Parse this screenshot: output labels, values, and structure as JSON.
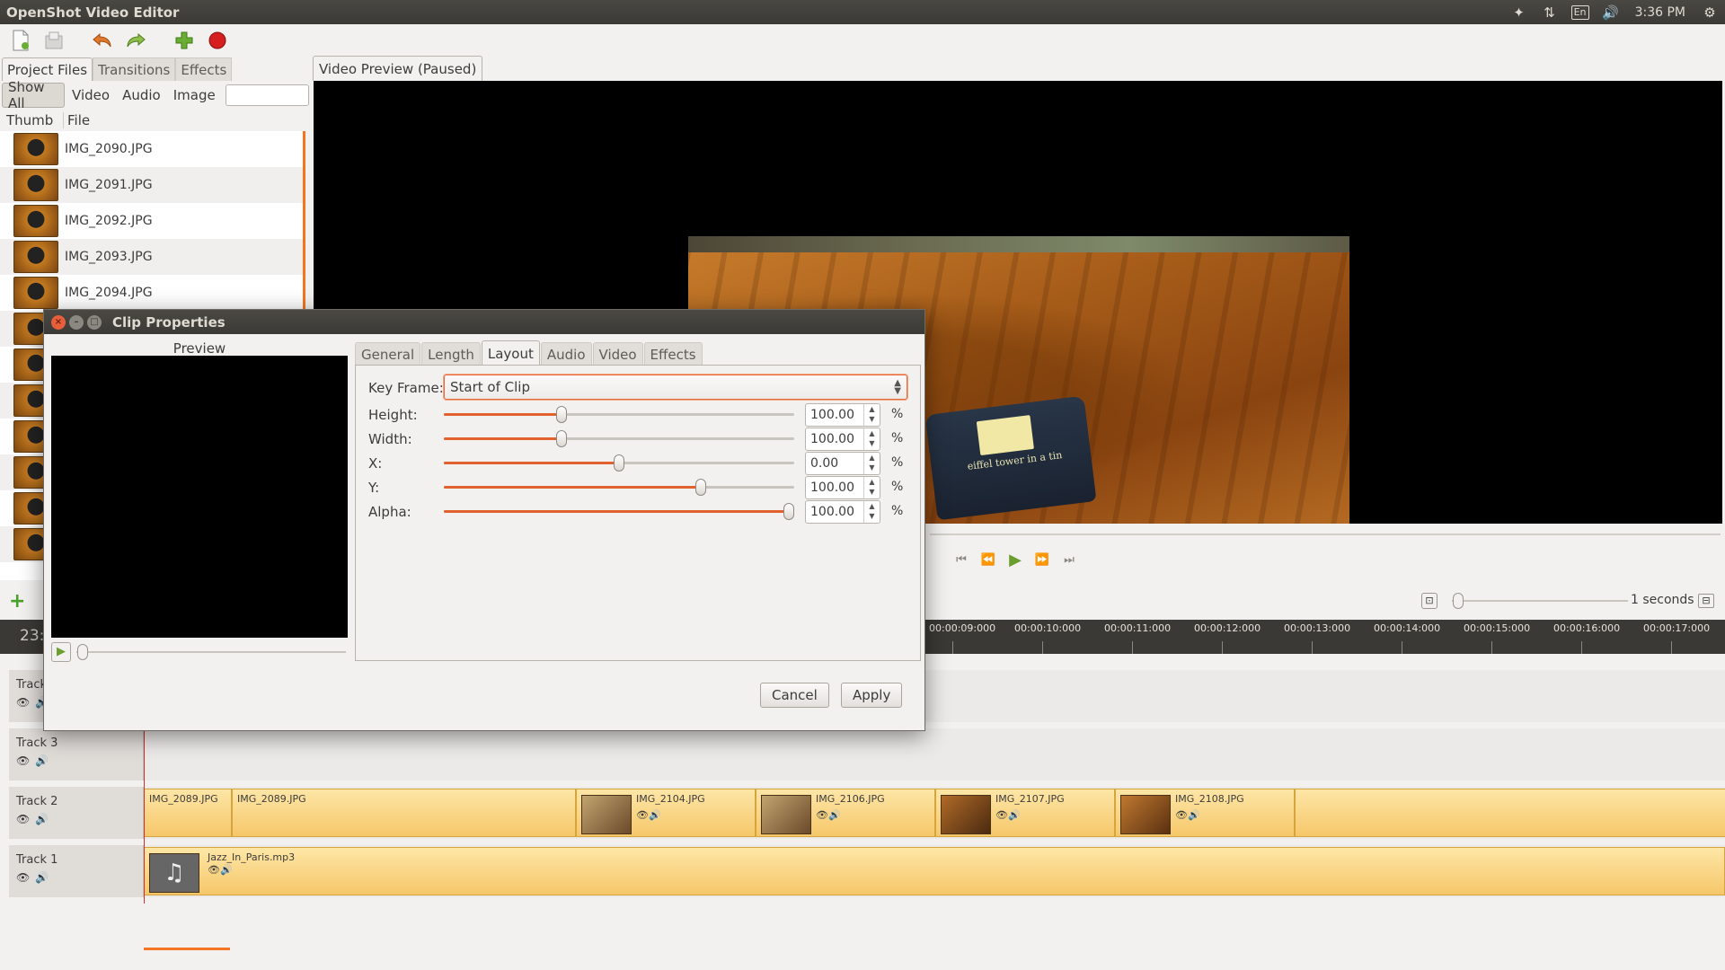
{
  "window": {
    "title": "OpenShot Video Editor",
    "indicators": {
      "keyboard": "En",
      "clock": "3:36 PM"
    }
  },
  "toolbar": {
    "new_icon": "new-project-icon",
    "save_icon": "save-icon",
    "undo_icon": "undo-icon",
    "redo_icon": "redo-icon",
    "import_icon": "add-icon",
    "record_icon": "record-icon"
  },
  "left_tabs": [
    "Project Files",
    "Transitions",
    "Effects"
  ],
  "filters": {
    "buttons": [
      "Show All",
      "Video",
      "Audio",
      "Image"
    ],
    "search_value": ""
  },
  "files": {
    "headers": {
      "thumb": "Thumb",
      "file": "File"
    },
    "rows": [
      "IMG_2090.JPG",
      "IMG_2091.JPG",
      "IMG_2092.JPG",
      "IMG_2093.JPG",
      "IMG_2094.JPG"
    ]
  },
  "preview": {
    "tab_label": "Video Preview (Paused)",
    "tin_text": "eiffel tower in a tin"
  },
  "timeline": {
    "zoom_label": "1 seconds",
    "current_time": "23:",
    "ticks": [
      "00:00:09:000",
      "00:00:10:000",
      "00:00:11:000",
      "00:00:12:000",
      "00:00:13:000",
      "00:00:14:000",
      "00:00:15:000",
      "00:00:16:000",
      "00:00:17:000"
    ],
    "tracks": [
      {
        "name": "Track",
        "clips": []
      },
      {
        "name": "Track 3",
        "clips": []
      },
      {
        "name": "Track 2",
        "clips": [
          "IMG_2089.JPG",
          "IMG_2089.JPG",
          "IMG_2104.JPG",
          "IMG_2106.JPG",
          "IMG_2107.JPG",
          "IMG_2108.JPG"
        ]
      },
      {
        "name": "Track 1",
        "clips": [
          "Jazz_In_Paris.mp3"
        ]
      }
    ]
  },
  "dialog": {
    "title": "Clip Properties",
    "preview_label": "Preview",
    "tabs": [
      "General",
      "Length",
      "Layout",
      "Audio",
      "Video",
      "Effects"
    ],
    "active_tab": "Layout",
    "keyframe_label": "Key Frame:",
    "keyframe_value": "Start of Clip",
    "properties": [
      {
        "label": "Height:",
        "value": "100.00",
        "unit": "%",
        "level": 0.33
      },
      {
        "label": "Width:",
        "value": "100.00",
        "unit": "%",
        "level": 0.33
      },
      {
        "label": "X:",
        "value": "0.00",
        "unit": "%",
        "level": 0.5
      },
      {
        "label": "Y:",
        "value": "100.00",
        "unit": "%",
        "level": 0.74
      },
      {
        "label": "Alpha:",
        "value": "100.00",
        "unit": "%",
        "level": 1.0
      }
    ],
    "cancel_label": "Cancel",
    "apply_label": "Apply"
  },
  "colors": {
    "accent": "#e1622f",
    "clip": "#f6c76a",
    "titlebar": "#3b3a36"
  }
}
